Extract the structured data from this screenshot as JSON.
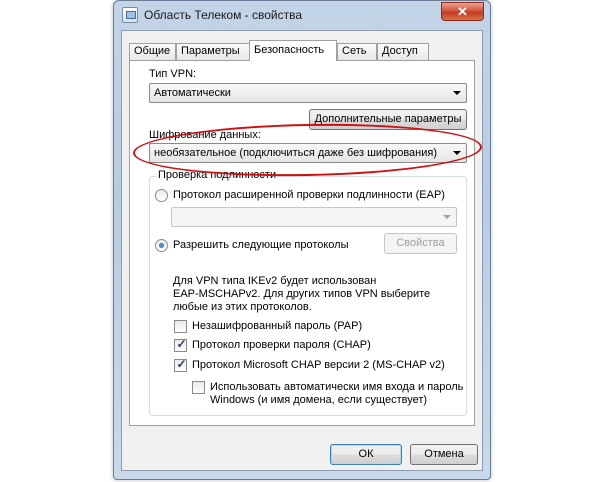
{
  "window": {
    "title": "Область Телеком - свойства",
    "close_label": "✕"
  },
  "tabs": [
    {
      "label": "Общие"
    },
    {
      "label": "Параметры"
    },
    {
      "label": "Безопасность"
    },
    {
      "label": "Сеть"
    },
    {
      "label": "Доступ"
    }
  ],
  "active_tab": "Безопасность",
  "security": {
    "vpn_type_label": "Тип VPN:",
    "vpn_type_value": "Автоматически",
    "advanced_button": "Дополнительные параметры",
    "encryption_label": "Шифрование данных:",
    "encryption_value": "необязательное (подключиться даже без шифрования)",
    "auth_group_label": "Проверка подлинности",
    "eap_radio_label": "Протокол расширенной проверки подлинности (EAP)",
    "eap_combo_value": "",
    "allow_radio_label": "Разрешить следующие протоколы",
    "properties_button": "Свойства",
    "note_line1": "Для VPN типа IKEv2 будет использован",
    "note_line2": "EAP-MSCHAPv2. Для других типов VPN выберите",
    "note_line3": "любые из этих протоколов.",
    "pap_label": "Незашифрованный пароль (PAP)",
    "chap_label": "Протокол проверки пароля (CHAP)",
    "mschap_label": "Протокол Microsoft CHAP версии 2 (MS-CHAP v2)",
    "autologon_line1": "Использовать автоматически имя входа и пароль",
    "autologon_line2": "Windows (и имя домена, если существует)",
    "eap_selected": false,
    "allow_selected": true,
    "pap_checked": false,
    "chap_checked": true,
    "mschap_checked": true,
    "autologon_checked": false
  },
  "footer": {
    "ok_label": "ОК",
    "cancel_label": "Отмена"
  },
  "colors": {
    "highlight": "#d01010"
  }
}
